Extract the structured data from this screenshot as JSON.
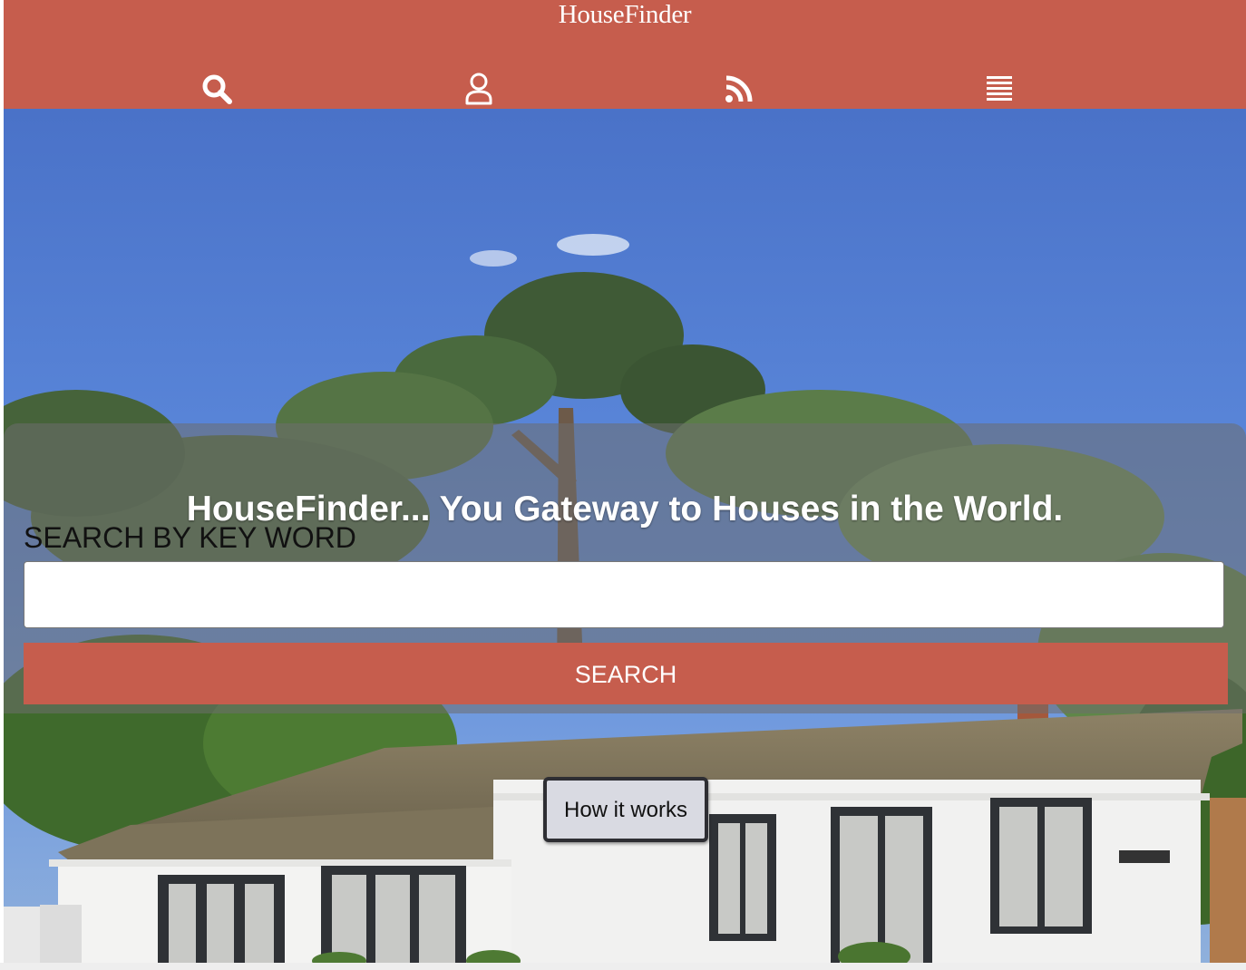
{
  "header": {
    "brand": "HouseFinder",
    "nav": [
      {
        "icon": "search-icon"
      },
      {
        "icon": "user-icon"
      },
      {
        "icon": "rss-icon"
      },
      {
        "icon": "menu-icon"
      }
    ]
  },
  "hero": {
    "title": "HouseFinder... You Gateway to Houses in the World.",
    "image": "house-photo",
    "search": {
      "label": "SEARCH BY KEY WORD",
      "value": "",
      "placeholder": "",
      "button_label": "SEARCH"
    },
    "how_it_works_label": "How it works"
  },
  "colors": {
    "brand": "#c65d4d",
    "header_text": "#ffffff"
  }
}
